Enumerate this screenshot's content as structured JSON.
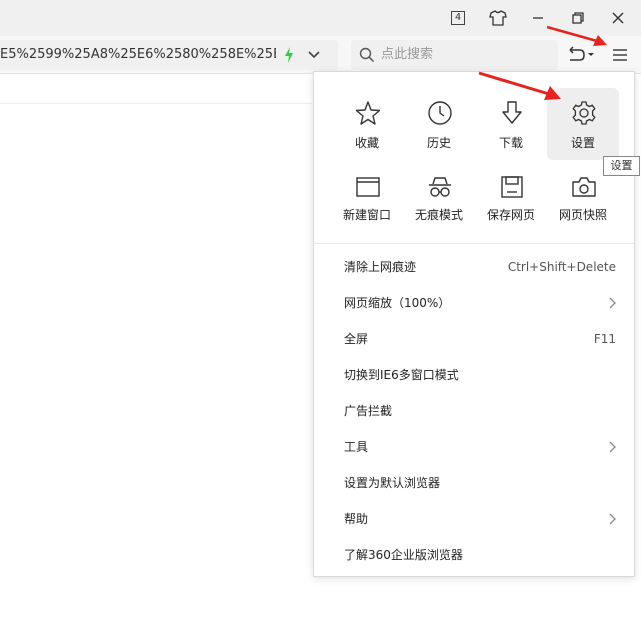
{
  "titlebar": {
    "tab_count": "4"
  },
  "address": {
    "url_fragment": "E5%2599%25A8%25E6%2580%258E%25E"
  },
  "search": {
    "placeholder": "点此搜索"
  },
  "menu": {
    "grid": [
      {
        "label": "收藏",
        "icon": "star-icon"
      },
      {
        "label": "历史",
        "icon": "clock-icon"
      },
      {
        "label": "下载",
        "icon": "download-icon"
      },
      {
        "label": "设置",
        "icon": "gear-icon"
      },
      {
        "label": "新建窗口",
        "icon": "new-window-icon"
      },
      {
        "label": "无痕模式",
        "icon": "incognito-icon"
      },
      {
        "label": "保存网页",
        "icon": "save-icon"
      },
      {
        "label": "网页快照",
        "icon": "camera-icon"
      }
    ],
    "items": [
      {
        "label": "清除上网痕迹",
        "shortcut": "Ctrl+Shift+Delete"
      },
      {
        "label": "网页缩放（100%）"
      },
      {
        "label": "全屏",
        "shortcut": "F11"
      },
      {
        "label": "切换到IE6多窗口模式"
      },
      {
        "label": "广告拦截"
      },
      {
        "label": "工具"
      },
      {
        "label": "设置为默认浏览器"
      },
      {
        "label": "帮助"
      },
      {
        "label": "了解360企业版浏览器"
      }
    ]
  },
  "tooltip": {
    "text": "设置"
  },
  "colors": {
    "accent_green": "#2ecc40",
    "annotation_red": "#e8231b"
  }
}
